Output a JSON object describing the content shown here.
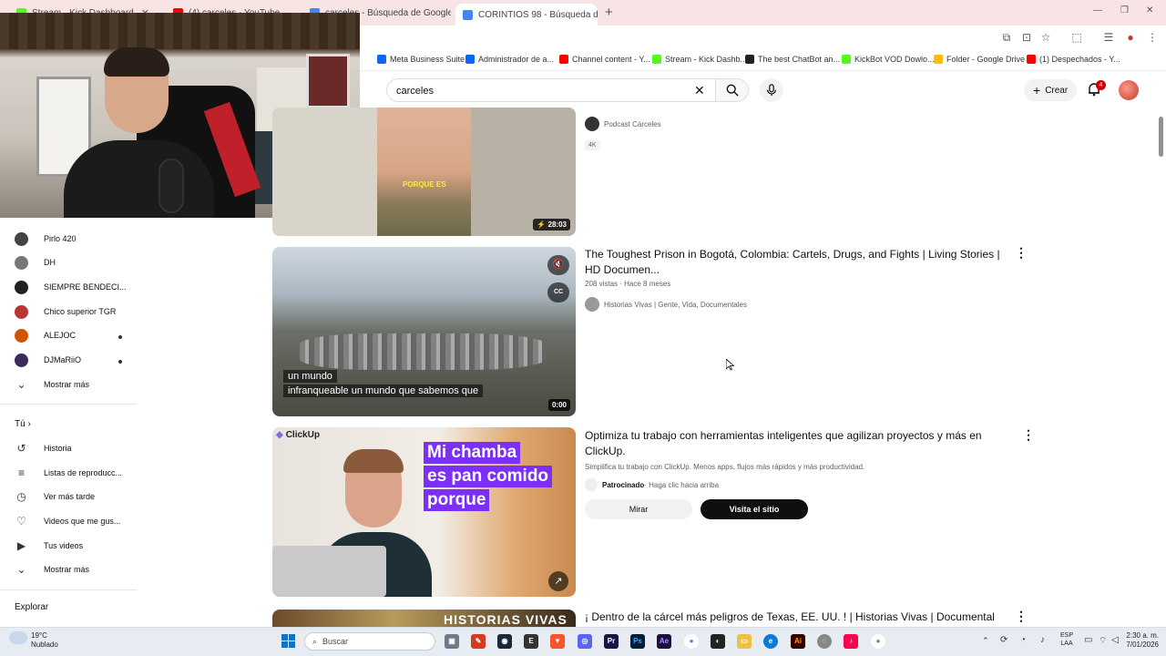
{
  "browser": {
    "tabs": [
      {
        "label": "Stream · Kick Dashboard",
        "color": "#53fc18"
      },
      {
        "label": "(4) carceles - YouTube",
        "color": "#ff0000"
      },
      {
        "label": "carceles - Búsqueda de Google",
        "color": "#4285f4"
      },
      {
        "label": "CORINTIOS 98 - Búsqueda de G",
        "color": "#4285f4"
      }
    ],
    "bookmarks": [
      {
        "label": "Meta Business Suite",
        "color": "#0866ff"
      },
      {
        "label": "Administrador de a...",
        "color": "#0866ff"
      },
      {
        "label": "Channel content - Y...",
        "color": "#ff0000"
      },
      {
        "label": "Stream - Kick Dashb...",
        "color": "#53fc18"
      },
      {
        "label": "The best ChatBot an...",
        "color": "#222222"
      },
      {
        "label": "KickBot VOD Dowlo...",
        "color": "#53fc18"
      },
      {
        "label": "Folder - Google Drive",
        "color": "#fbbc04"
      },
      {
        "label": "(1) Despechados - Y...",
        "color": "#ff0000"
      }
    ]
  },
  "header": {
    "search_value": "carceles",
    "create_label": "Crear",
    "notification_count": "4"
  },
  "sidebar": {
    "subscriptions": [
      {
        "label": "Pirlo 420",
        "color": "#444",
        "dot": false
      },
      {
        "label": "DH",
        "color": "#777",
        "dot": false
      },
      {
        "label": "SIEMPRE BENDECI...",
        "color": "#222",
        "dot": false
      },
      {
        "label": "Chico superior TGR",
        "color": "#b33",
        "dot": false
      },
      {
        "label": "ALEJOC",
        "color": "#d35400",
        "dot": true
      },
      {
        "label": "DJMaRiiO",
        "color": "#3b2a5a",
        "dot": true
      }
    ],
    "show_more": "Mostrar más",
    "you_heading": "Tú",
    "you_items": [
      {
        "label": "Historia",
        "icon": "history-icon",
        "glyph": "↺"
      },
      {
        "label": "Listas de reproducc...",
        "icon": "playlist-icon",
        "glyph": "≡"
      },
      {
        "label": "Ver más tarde",
        "icon": "clock-icon",
        "glyph": "◷"
      },
      {
        "label": "Videos que me gus...",
        "icon": "like-icon",
        "glyph": "👍"
      },
      {
        "label": "Tus videos",
        "icon": "video-icon",
        "glyph": "▶"
      }
    ],
    "show_more_2": "Mostrar más",
    "explore_heading": "Explorar"
  },
  "results": [
    {
      "channel": "Podcast Cárceles",
      "badge": "4K",
      "duration": "28:03",
      "caption": "PORQUE ES"
    },
    {
      "title": "The Toughest Prison in Bogotá, Colombia: Cartels, Drugs, and Fights | Living Stories | HD Documen...",
      "meta": "208 vistas · Hace 8 meses",
      "channel": "Historias Vivas | Gente, Vida, Documentales",
      "duration": "0:00",
      "subtitle_line1": "un mundo",
      "subtitle_line2": "infranqueable un mundo que sabemos que"
    },
    {
      "title": "Optimiza tu trabajo con herramientas inteligentes que agilizan proyectos y más en ClickUp.",
      "description": "Simplifica tu trabajo con ClickUp. Menos apps, flujos más rápidos y más productividad.",
      "sponsored": "Patrocinado",
      "sponsored_hint": " · Haga clic hacia arriba",
      "watch_label": "Mirar",
      "visit_label": "Visita el sitio",
      "brand": "ClickUp",
      "ad_text_1": "Mi chamba",
      "ad_text_2": "es pan comido",
      "ad_text_3": "porque"
    },
    {
      "title": "¡ Dentro de la cárcel más peligros de Texas, EE. UU. ! | Historias Vivas | Documental",
      "thumb_text": "HISTORIAS VIVAS"
    }
  ],
  "taskbar": {
    "weather_temp": "19°C",
    "weather_desc": "Nublado",
    "search_placeholder": "Buscar",
    "lang_1": "ESP",
    "lang_2": "LAA",
    "time": "2:30 a. m.",
    "date": "7/01/2026"
  }
}
